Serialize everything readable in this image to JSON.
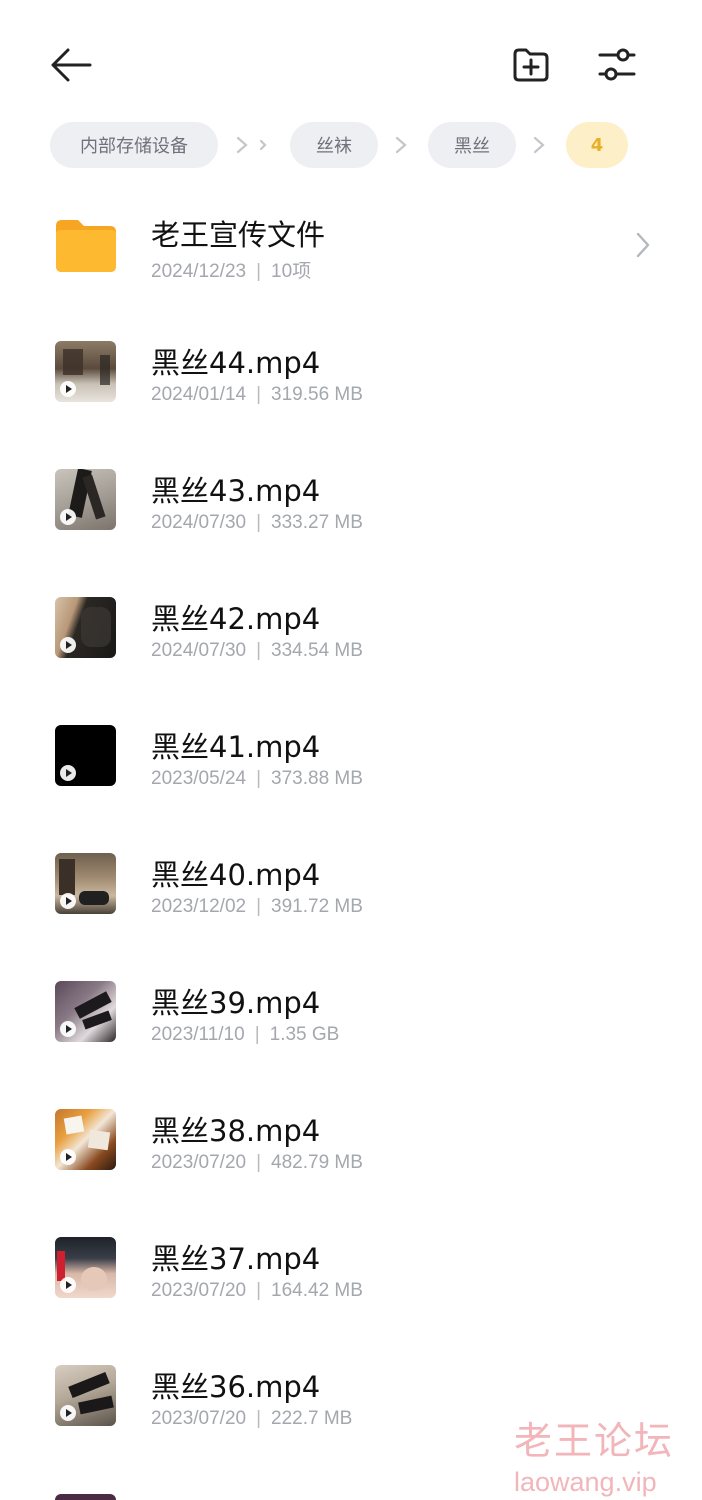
{
  "breadcrumb": [
    "内部存储设备",
    "丝袜",
    "黑丝",
    "4"
  ],
  "folder": {
    "name": "老王宣传文件",
    "date": "2024/12/23",
    "info": "10项"
  },
  "files": [
    {
      "name": "黑丝44.mp4",
      "date": "2024/01/14",
      "size": "319.56 MB"
    },
    {
      "name": "黑丝43.mp4",
      "date": "2024/07/30",
      "size": "333.27 MB"
    },
    {
      "name": "黑丝42.mp4",
      "date": "2024/07/30",
      "size": "334.54 MB"
    },
    {
      "name": "黑丝41.mp4",
      "date": "2023/05/24",
      "size": "373.88 MB"
    },
    {
      "name": "黑丝40.mp4",
      "date": "2023/12/02",
      "size": "391.72 MB"
    },
    {
      "name": "黑丝39.mp4",
      "date": "2023/11/10",
      "size": "1.35 GB"
    },
    {
      "name": "黑丝38.mp4",
      "date": "2023/07/20",
      "size": "482.79 MB"
    },
    {
      "name": "黑丝37.mp4",
      "date": "2023/07/20",
      "size": "164.42 MB"
    },
    {
      "name": "黑丝36.mp4",
      "date": "2023/07/20",
      "size": "222.7 MB"
    }
  ],
  "watermark": {
    "cn": "老王论坛",
    "url": "laowang.vip"
  },
  "icons": {
    "back": "arrow-left-icon",
    "new_folder": "folder-plus-icon",
    "filter": "sliders-icon",
    "folder": "folder-icon",
    "chevron": "chevron-right-icon",
    "video": "video-thumbnail"
  },
  "colors": {
    "chip_bg": "#eeeff3",
    "chip_active_bg": "#fdf0c8",
    "chip_active_text": "#e9b027",
    "folder": "#fbb12b"
  }
}
